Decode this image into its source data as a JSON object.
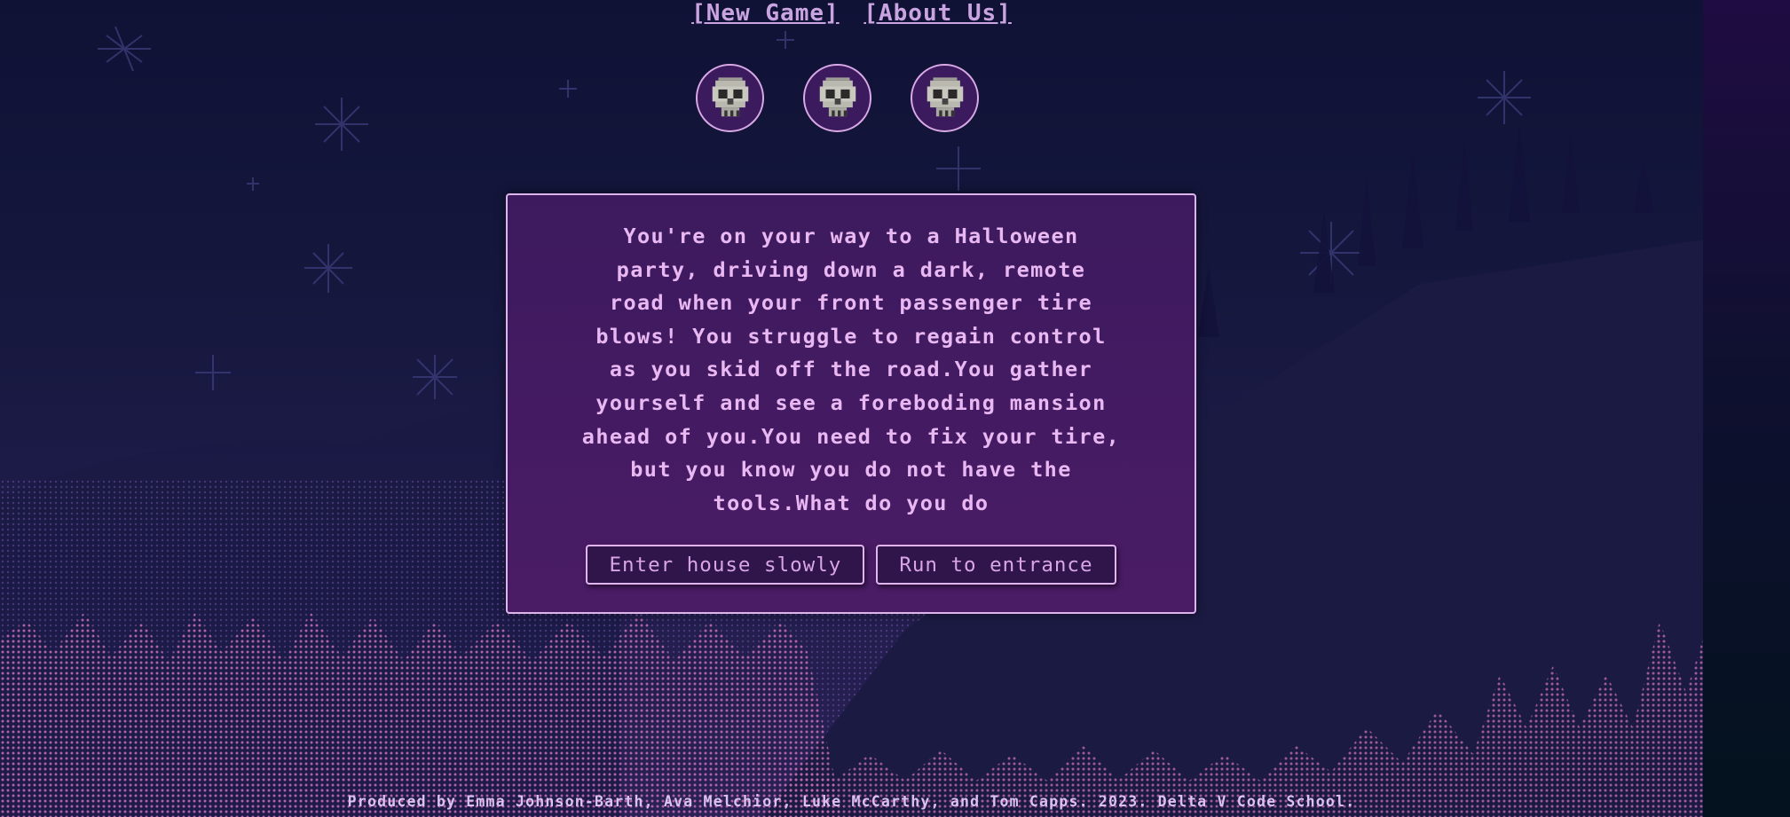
{
  "nav": {
    "new_game": "[New Game]",
    "about_us": "[About Us]"
  },
  "lives": {
    "count": 3,
    "icon": "skull-icon"
  },
  "story": {
    "text": "You're on your way to a Halloween\nparty, driving down a dark, remote\nroad when your front passenger tire\nblows! You struggle to regain control\nas you skid off the road.You gather\nyourself and see a foreboding mansion\nahead of you.You need to fix your tire,\nbut you know you do not have the\ntools.What do you do",
    "choices": [
      "Enter house slowly",
      "Run to entrance"
    ]
  },
  "footer": {
    "credits": "Produced by Emma Johnson-Barth, Ava Melchior, Luke McCarthy, and Tom Capps. 2023. Delta V Code School."
  },
  "colors": {
    "accent": "#e9b8f2",
    "panel": "#42195f",
    "background": "#0f1235"
  }
}
